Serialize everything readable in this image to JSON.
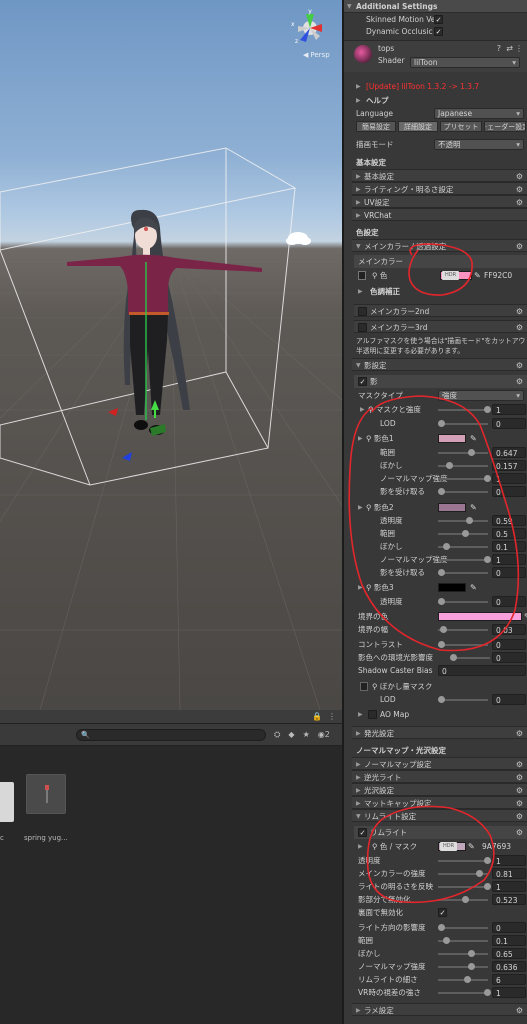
{
  "scene": {
    "persp_label": "Persp",
    "gizmo": {
      "y_label": "y",
      "x_label": "x",
      "z_label": "z"
    }
  },
  "bottom": {
    "search_placeholder": "",
    "eye_count": "2",
    "asset_name": "spring yug...",
    "asset_trailing": "c"
  },
  "inspector": {
    "additional_settings": "Additional Settings",
    "skinned_motion": "Skinned Motion Ve",
    "dynamic_occlusion": "Dynamic Occlusic",
    "material_name": "tops",
    "shader_label": "Shader",
    "shader_value": "lilToon",
    "update_notice": "[Update] lilToon 1.3.2 -> 1.3.7",
    "help": "ヘルプ",
    "language_label": "Language",
    "language_value": "Japanese",
    "tabs": [
      "簡易設定",
      "詳細設定",
      "プリセット",
      "·ェーダー設定"
    ],
    "render_mode_label": "描画モード",
    "render_mode_value": "不透明",
    "basic_settings": "基本設定",
    "basic_items": [
      "基本設定",
      "ライティング・明るさ設定",
      "UV設定",
      "VRChat"
    ],
    "color_settings": "色設定",
    "main_color_group": "メインカラー / 透過設定",
    "main_color": "メインカラー",
    "color_label": "色",
    "main_hex": "FF92C0",
    "color_correction": "色調補正",
    "main_color_2nd": "メインカラー2nd",
    "main_color_3rd": "メインカラー3rd",
    "alpha_note_1": "アルファマスクを使う場合は\"描画モード\"をカットアウトか",
    "alpha_note_2": "半透明に変更する必要があります。",
    "shadow_settings": "影設定",
    "shadow": "影",
    "mask_type_label": "マスクタイプ",
    "mask_type_value": "強度",
    "mask_strength_label": "マスクと強度",
    "mask_strength_value": "1",
    "lod_label": "LOD",
    "lod_value": "0",
    "shadow1": "影色1",
    "range_label": "範囲",
    "range1_value": "0.647",
    "blur_label": "ぼかし",
    "blur1_value": "0.157",
    "normal_map_strength_label": "ノーマルマップ強度",
    "normal1_value": "1",
    "receive_shadow_label": "影を受け取る",
    "receive1_value": "0",
    "shadow2": "影色2",
    "opacity_label": "透明度",
    "opacity2_value": "0.59",
    "range2_value": "0.5",
    "blur2_value": "0.1",
    "normal2_value": "1",
    "receive2_value": "0",
    "shadow3": "影色3",
    "opacity3_value": "0",
    "border_color_label": "境界の色",
    "border_width_label": "境界の幅",
    "border_width_value": "0.03",
    "contrast_label": "コントラスト",
    "contrast_value": "0",
    "env_shadow_label": "影色への環境光影響度",
    "env_shadow_value": "0",
    "caster_bias_label": "Shadow Caster Bias",
    "caster_bias_value": "0",
    "blur_mask_label": "ぼかし量マスク",
    "blur_lod_value": "0",
    "ao_map_label": "AO Map",
    "emission_settings": "発光設定",
    "normal_gloss_settings": "ノーマルマップ・光沢設定",
    "normal_items": [
      "ノーマルマップ設定",
      "逆光ライト",
      "光沢設定",
      "マットキャップ設定",
      "リムライト設定"
    ],
    "rim_light": "リムライト",
    "rim_color_label": "色 / マスク",
    "rim_hex": "9A7693",
    "rim_opacity_value": "1",
    "rim_main_strength_label": "メインカラーの強度",
    "rim_main_strength_value": "0.81",
    "rim_light_bright_label": "ライトの明るさを反映",
    "rim_light_bright_value": "1",
    "rim_shadow_disable_label": "影部分で無効化",
    "rim_shadow_disable_value": "0.523",
    "rim_backface_label": "裏面で無効化",
    "rim_light_dir_label": "ライト方向の影響度",
    "rim_light_dir_value": "0",
    "rim_range_value": "0.1",
    "rim_blur_value": "0.65",
    "rim_normal_value": "0.636",
    "rim_thickness_label": "リムライトの細さ",
    "rim_thickness_value": "6",
    "rim_vr_label": "VR時の視差の強さ",
    "rim_vr_value": "1",
    "glitter_settings": "ラメ設定"
  },
  "colors": {
    "main_color": "#ff92c0",
    "shadow1_color": "#d4a0b8",
    "shadow2_color": "#9a7693",
    "shadow3_color": "#000000",
    "border_color": "#f7a0dc",
    "rim_color": "#c0a8bc"
  },
  "icons": [
    "gear-icon",
    "eyedropper-icon",
    "lock-icon",
    "eye-icon",
    "search-icon"
  ]
}
